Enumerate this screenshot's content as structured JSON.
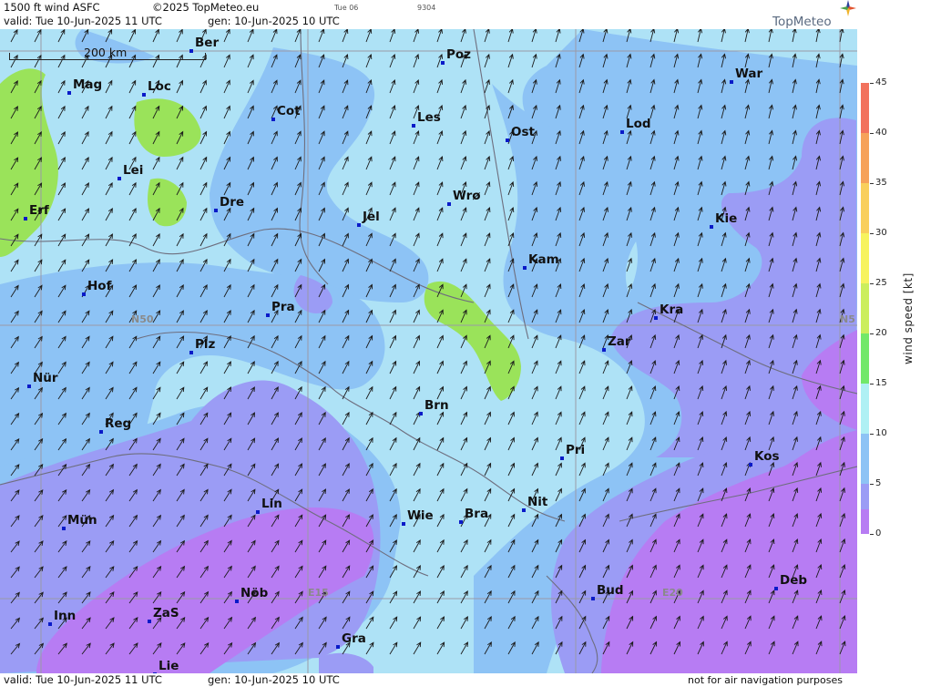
{
  "header": {
    "product": "1500 ft wind ASFC",
    "copyright": "©2025 TopMeteo.eu",
    "day_small": "Tue 06",
    "code_small": "9304",
    "valid_line": "valid:  Tue  10-Jun-2025  11 UTC",
    "gen_line": "gen:  10-Jun-2025 10 UTC",
    "logo": "TopMeteo"
  },
  "footer": {
    "valid_line": "valid:  Tue  10-Jun-2025  11 UTC",
    "gen_line": "gen:  10-Jun-2025 10 UTC",
    "disclaimer": "not for air navigation purposes"
  },
  "map": {
    "scale_label": "200 km",
    "grid_labels": {
      "lat1": "N50",
      "lat2": "N5",
      "lon1": "E15",
      "lon2": "E20"
    },
    "cities": [
      {
        "name": "Ber"
      },
      {
        "name": "Poz"
      },
      {
        "name": "Mag"
      },
      {
        "name": "Loc"
      },
      {
        "name": "War"
      },
      {
        "name": "Cot"
      },
      {
        "name": "Les"
      },
      {
        "name": "Lod"
      },
      {
        "name": "Ost"
      },
      {
        "name": "Lei"
      },
      {
        "name": "Wrø"
      },
      {
        "name": "Dre"
      },
      {
        "name": "Erf"
      },
      {
        "name": "Jel"
      },
      {
        "name": "Kie"
      },
      {
        "name": "Kam"
      },
      {
        "name": "Hof"
      },
      {
        "name": "Pra"
      },
      {
        "name": "Kra"
      },
      {
        "name": "Zar"
      },
      {
        "name": "Plz"
      },
      {
        "name": "Nür"
      },
      {
        "name": "Brn"
      },
      {
        "name": "Reg"
      },
      {
        "name": "Pri"
      },
      {
        "name": "Kos"
      },
      {
        "name": "Lin"
      },
      {
        "name": "Nit"
      },
      {
        "name": "Wie"
      },
      {
        "name": "Bra"
      },
      {
        "name": "Mün"
      },
      {
        "name": "Deb"
      },
      {
        "name": "Nöb"
      },
      {
        "name": "Bud"
      },
      {
        "name": "Inn"
      },
      {
        "name": "ZaS"
      },
      {
        "name": "Gra"
      },
      {
        "name": "Lie"
      }
    ]
  },
  "legend": {
    "units": "wind  speed  [kt]",
    "ticks": [
      "45",
      "40",
      "35",
      "30",
      "25",
      "20",
      "15",
      "10",
      "5",
      "0"
    ],
    "colors": [
      "#f2725d",
      "#f6a25a",
      "#f9cf5c",
      "#f7f35e",
      "#cbee5d",
      "#9ae35a",
      "#72e86a",
      "#aff0f4",
      "#8dc3f5",
      "#9b9cf5",
      "#b77cf3"
    ]
  }
}
